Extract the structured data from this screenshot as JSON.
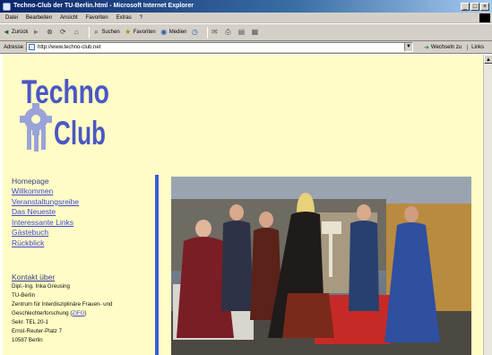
{
  "window": {
    "title": "Techno-Club der TU-Berlin.html - Microsoft Internet Explorer",
    "buttons": [
      "_",
      "□",
      "×"
    ]
  },
  "menu": [
    "Datei",
    "Bearbeiten",
    "Ansicht",
    "Favoriten",
    "Extras",
    "?"
  ],
  "toolbar": {
    "back": "Zurück",
    "search": "Suchen",
    "favorites": "Favoriten",
    "media": "Medien"
  },
  "address": {
    "label": "Adresse",
    "url": "http://www.techno-club.net",
    "go": "Wechseln zu",
    "links": "Links"
  },
  "page": {
    "logo_line1": "Techno",
    "logo_line2": "Club",
    "nav_home": "Homepage",
    "nav_links": [
      "Willkommen",
      "Veranstaltungsreihe",
      "Das Neueste",
      "Interessante Links",
      "Gästebuch",
      "Rückblick"
    ],
    "contact": {
      "heading": "Kontakt über",
      "lines": [
        "Dipl.-Ing. Inka Greusing",
        "TU-Berlin",
        "Zentrum für Interdisziplinäre Frauen- und",
        "Geschlechterforschung ",
        "Sekr. TEL 20-1",
        "Ernst-Reuter-Platz 7",
        "10587 Berlin"
      ],
      "zifg": "ZIFG"
    }
  },
  "colors": {
    "page_bg": "#fffdc5",
    "link": "#3f46d8",
    "logo": "#4b57c4",
    "bar": "#3b5cdc"
  }
}
